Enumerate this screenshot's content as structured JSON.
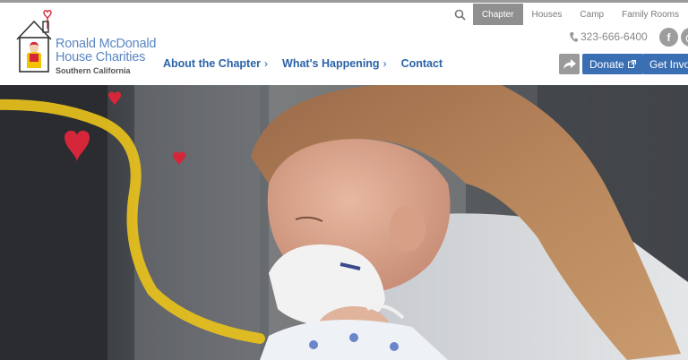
{
  "utility_nav": {
    "tabs": [
      "Chapter",
      "Houses",
      "Camp",
      "Family Rooms"
    ],
    "active_tab": "Chapter",
    "search_icon": "search-icon"
  },
  "logo": {
    "line1": "Ronald McDonald",
    "line2": "House Charities",
    "sub": "Southern California"
  },
  "main_nav": {
    "items": [
      {
        "label": "About the Chapter",
        "has_chevron": true
      },
      {
        "label": "What's Happening",
        "has_chevron": true
      },
      {
        "label": "Contact",
        "has_chevron": false
      }
    ],
    "chevron": "›"
  },
  "contact": {
    "phone": "323-666-6400",
    "phone_icon": "phone-icon"
  },
  "social": {
    "facebook": "f",
    "instagram": "◎"
  },
  "actions": {
    "share_icon": "share-arrow-icon",
    "donate": "Donate",
    "get_involved": "Get Invo"
  },
  "colors": {
    "brand_blue": "#3a6fb3",
    "nav_blue": "#2a63a8",
    "logo_blue": "#5a86c4",
    "active_tab_gray": "#8f8f8f",
    "heart_red": "#d6263a",
    "ribbon_yellow": "#e8c11c"
  }
}
